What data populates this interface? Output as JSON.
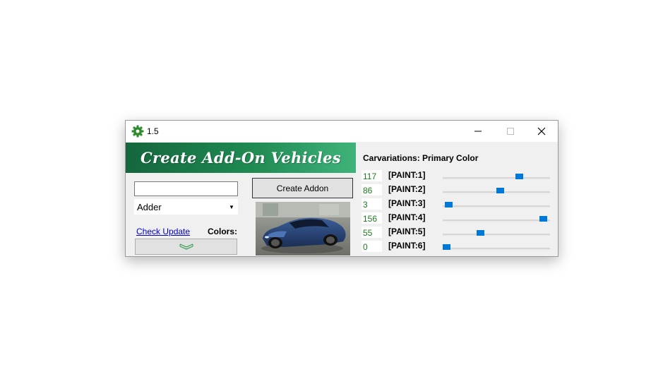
{
  "window": {
    "title": "1.5",
    "banner_text": "Create Add-On Vehicles",
    "name_input_value": "",
    "vehicle_select": "Adder",
    "create_button_label": "Create Addon",
    "check_update_label": "Check Update",
    "colors_label": "Colors:",
    "car_image_icon": "car-thumbnail"
  },
  "carvariations": {
    "title": "Carvariations: Primary Color",
    "max": 160,
    "paints": [
      {
        "value": "117",
        "label": "[PAINT:1]",
        "level": 117
      },
      {
        "value": "86",
        "label": "[PAINT:2]",
        "level": 86
      },
      {
        "value": "3",
        "label": "[PAINT:3]",
        "level": 3
      },
      {
        "value": "156",
        "label": "[PAINT:4]",
        "level": 156
      },
      {
        "value": "55",
        "label": "[PAINT:5]",
        "level": 55
      },
      {
        "value": "0",
        "label": "[PAINT:6]",
        "level": 0
      }
    ]
  },
  "colors": {
    "banner_start": "#15663d",
    "banner_end": "#3fb37b",
    "paint_value_text": "#1f7a1f",
    "slider_thumb": "#0078d7",
    "app_icon": "#2e8b2e"
  }
}
